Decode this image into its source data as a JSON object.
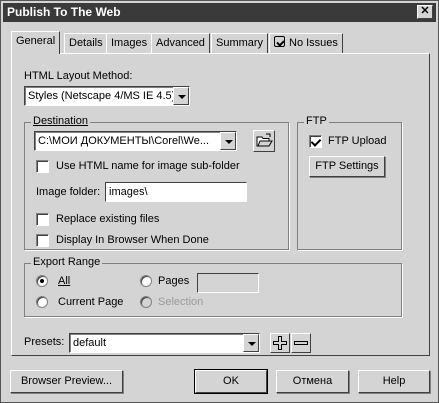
{
  "window": {
    "title": "Publish To The Web",
    "close_glyph": "✕"
  },
  "tabs": [
    {
      "label": "General",
      "active": true
    },
    {
      "label": "Details"
    },
    {
      "label": "Images"
    },
    {
      "label": "Advanced"
    },
    {
      "label": "Summary"
    },
    {
      "label": "No Issues",
      "icon": "check-hint-icon"
    }
  ],
  "layout_method": {
    "label": "HTML Layout Method:",
    "value": "Styles (Netscape 4/MS IE 4.5)"
  },
  "destination": {
    "title": "Destination",
    "path": "C:\\МОИ ДОКУМЕНТЫ\\Corel\\We...",
    "use_html_name_label": "Use HTML name for image sub-folder",
    "image_folder_label": "Image folder:",
    "image_folder_value": "images\\",
    "replace_label": "Replace existing files",
    "display_label": "Display In Browser When Done"
  },
  "ftp": {
    "title": "FTP",
    "upload_label": "FTP Upload",
    "settings_label": "FTP Settings"
  },
  "export_range": {
    "title": "Export Range",
    "all_label": "All",
    "pages_label": "Pages",
    "current_page_label": "Current Page",
    "selection_label": "Selection"
  },
  "presets": {
    "label": "Presets:",
    "value": "default"
  },
  "footer": {
    "browser_preview_label": "Browser Preview...",
    "ok_label": "OK",
    "cancel_label": "Отмена",
    "help_label": "Help"
  }
}
